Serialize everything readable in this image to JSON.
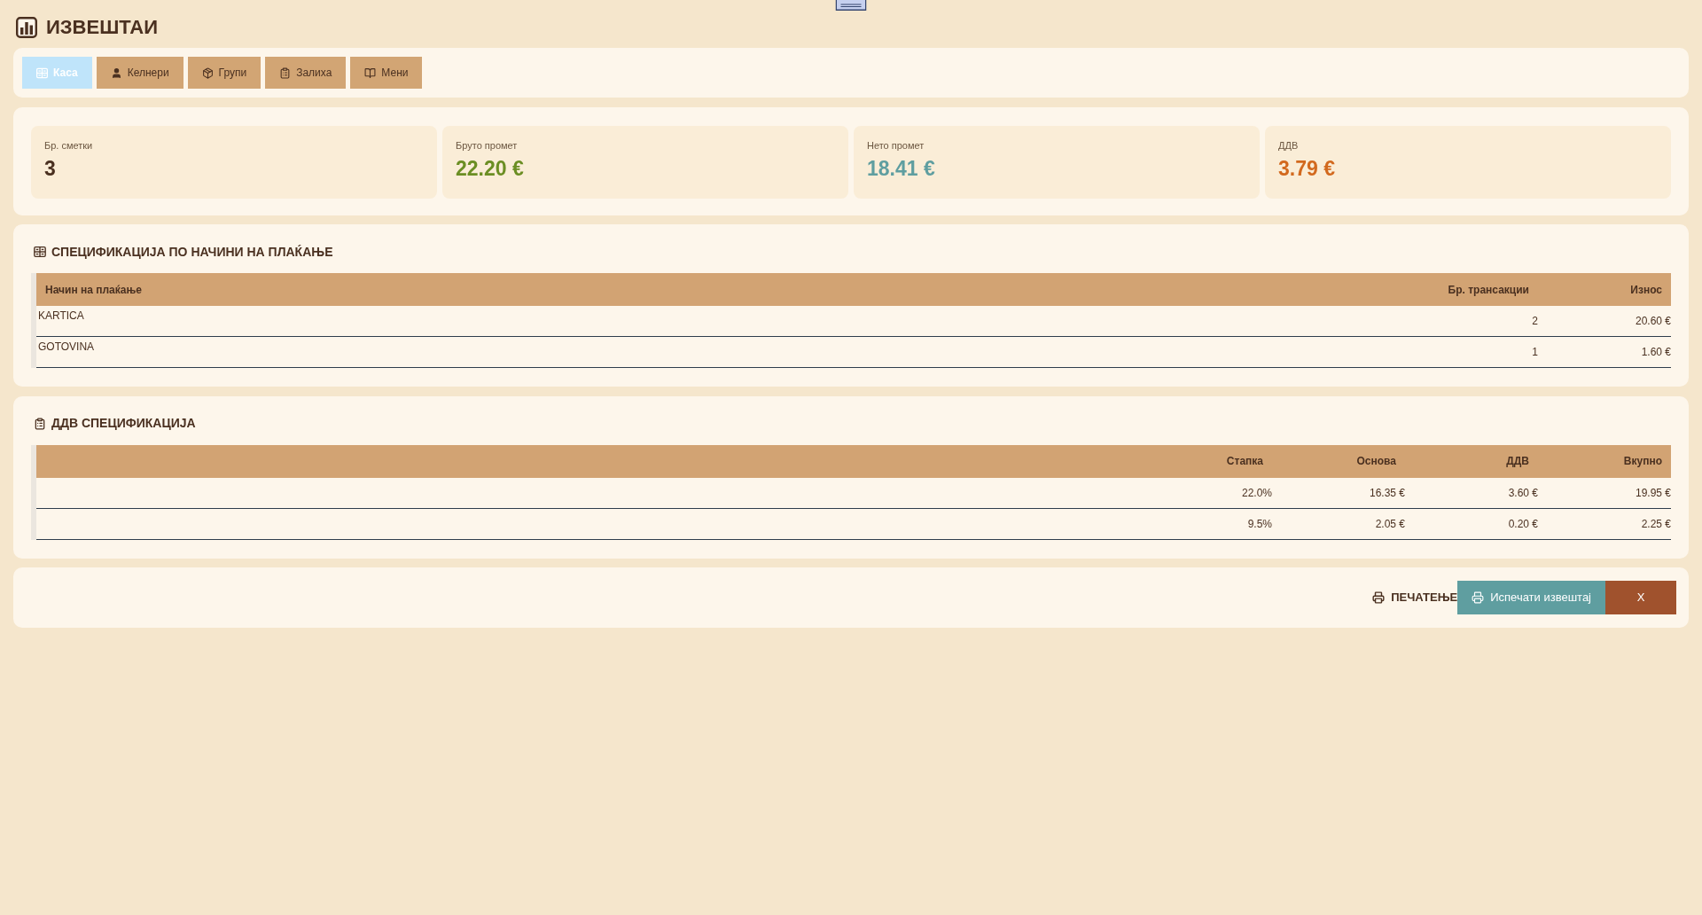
{
  "header": {
    "title": "ИЗВЕШТАИ"
  },
  "tabs": [
    {
      "label": "Каса",
      "selected": true
    },
    {
      "label": "Келнери",
      "selected": false
    },
    {
      "label": "Групи",
      "selected": false
    },
    {
      "label": "Залиха",
      "selected": false
    },
    {
      "label": "Мени",
      "selected": false
    }
  ],
  "summary_cards": [
    {
      "label": "Бр. сметки",
      "value": "3",
      "color": "#4a3020"
    },
    {
      "label": "Бруто промет",
      "value": "22.20 €",
      "color": "#6b8e23"
    },
    {
      "label": "Нето промет",
      "value": "18.41 €",
      "color": "#5f9ea0"
    },
    {
      "label": "ДДВ",
      "value": "3.79 €",
      "color": "#d2691e"
    }
  ],
  "payment_methods": {
    "title": "СПЕЦИФИКАЦИЈА ПО НАЧИНИ НА ПЛАЌАЊЕ",
    "columns": [
      "Начин на плаќање",
      "Бр. трансакции",
      "Износ"
    ],
    "rows": [
      {
        "method": "KARTICA",
        "transactions": "2",
        "amount": "20.60 €"
      },
      {
        "method": "GOTOVINA",
        "transactions": "1",
        "amount": "1.60 €"
      }
    ]
  },
  "vat_breakdown": {
    "title": "ДДВ СПЕЦИФИКАЦИЈА",
    "columns": [
      "Стапка",
      "Основа",
      "ДДВ",
      "Вкупно"
    ],
    "rows": [
      {
        "rate": "22.0%",
        "base": "16.35 €",
        "vat": "3.60 €",
        "total": "19.95 €"
      },
      {
        "rate": "9.5%",
        "base": "2.05 €",
        "vat": "0.20 €",
        "total": "2.25 €"
      }
    ]
  },
  "print_bar": {
    "label": "ПЕЧАТЕЊЕ",
    "buttons": [
      {
        "label": "Испечати извештај",
        "kind": "print"
      },
      {
        "label": "X",
        "kind": "close"
      }
    ]
  }
}
